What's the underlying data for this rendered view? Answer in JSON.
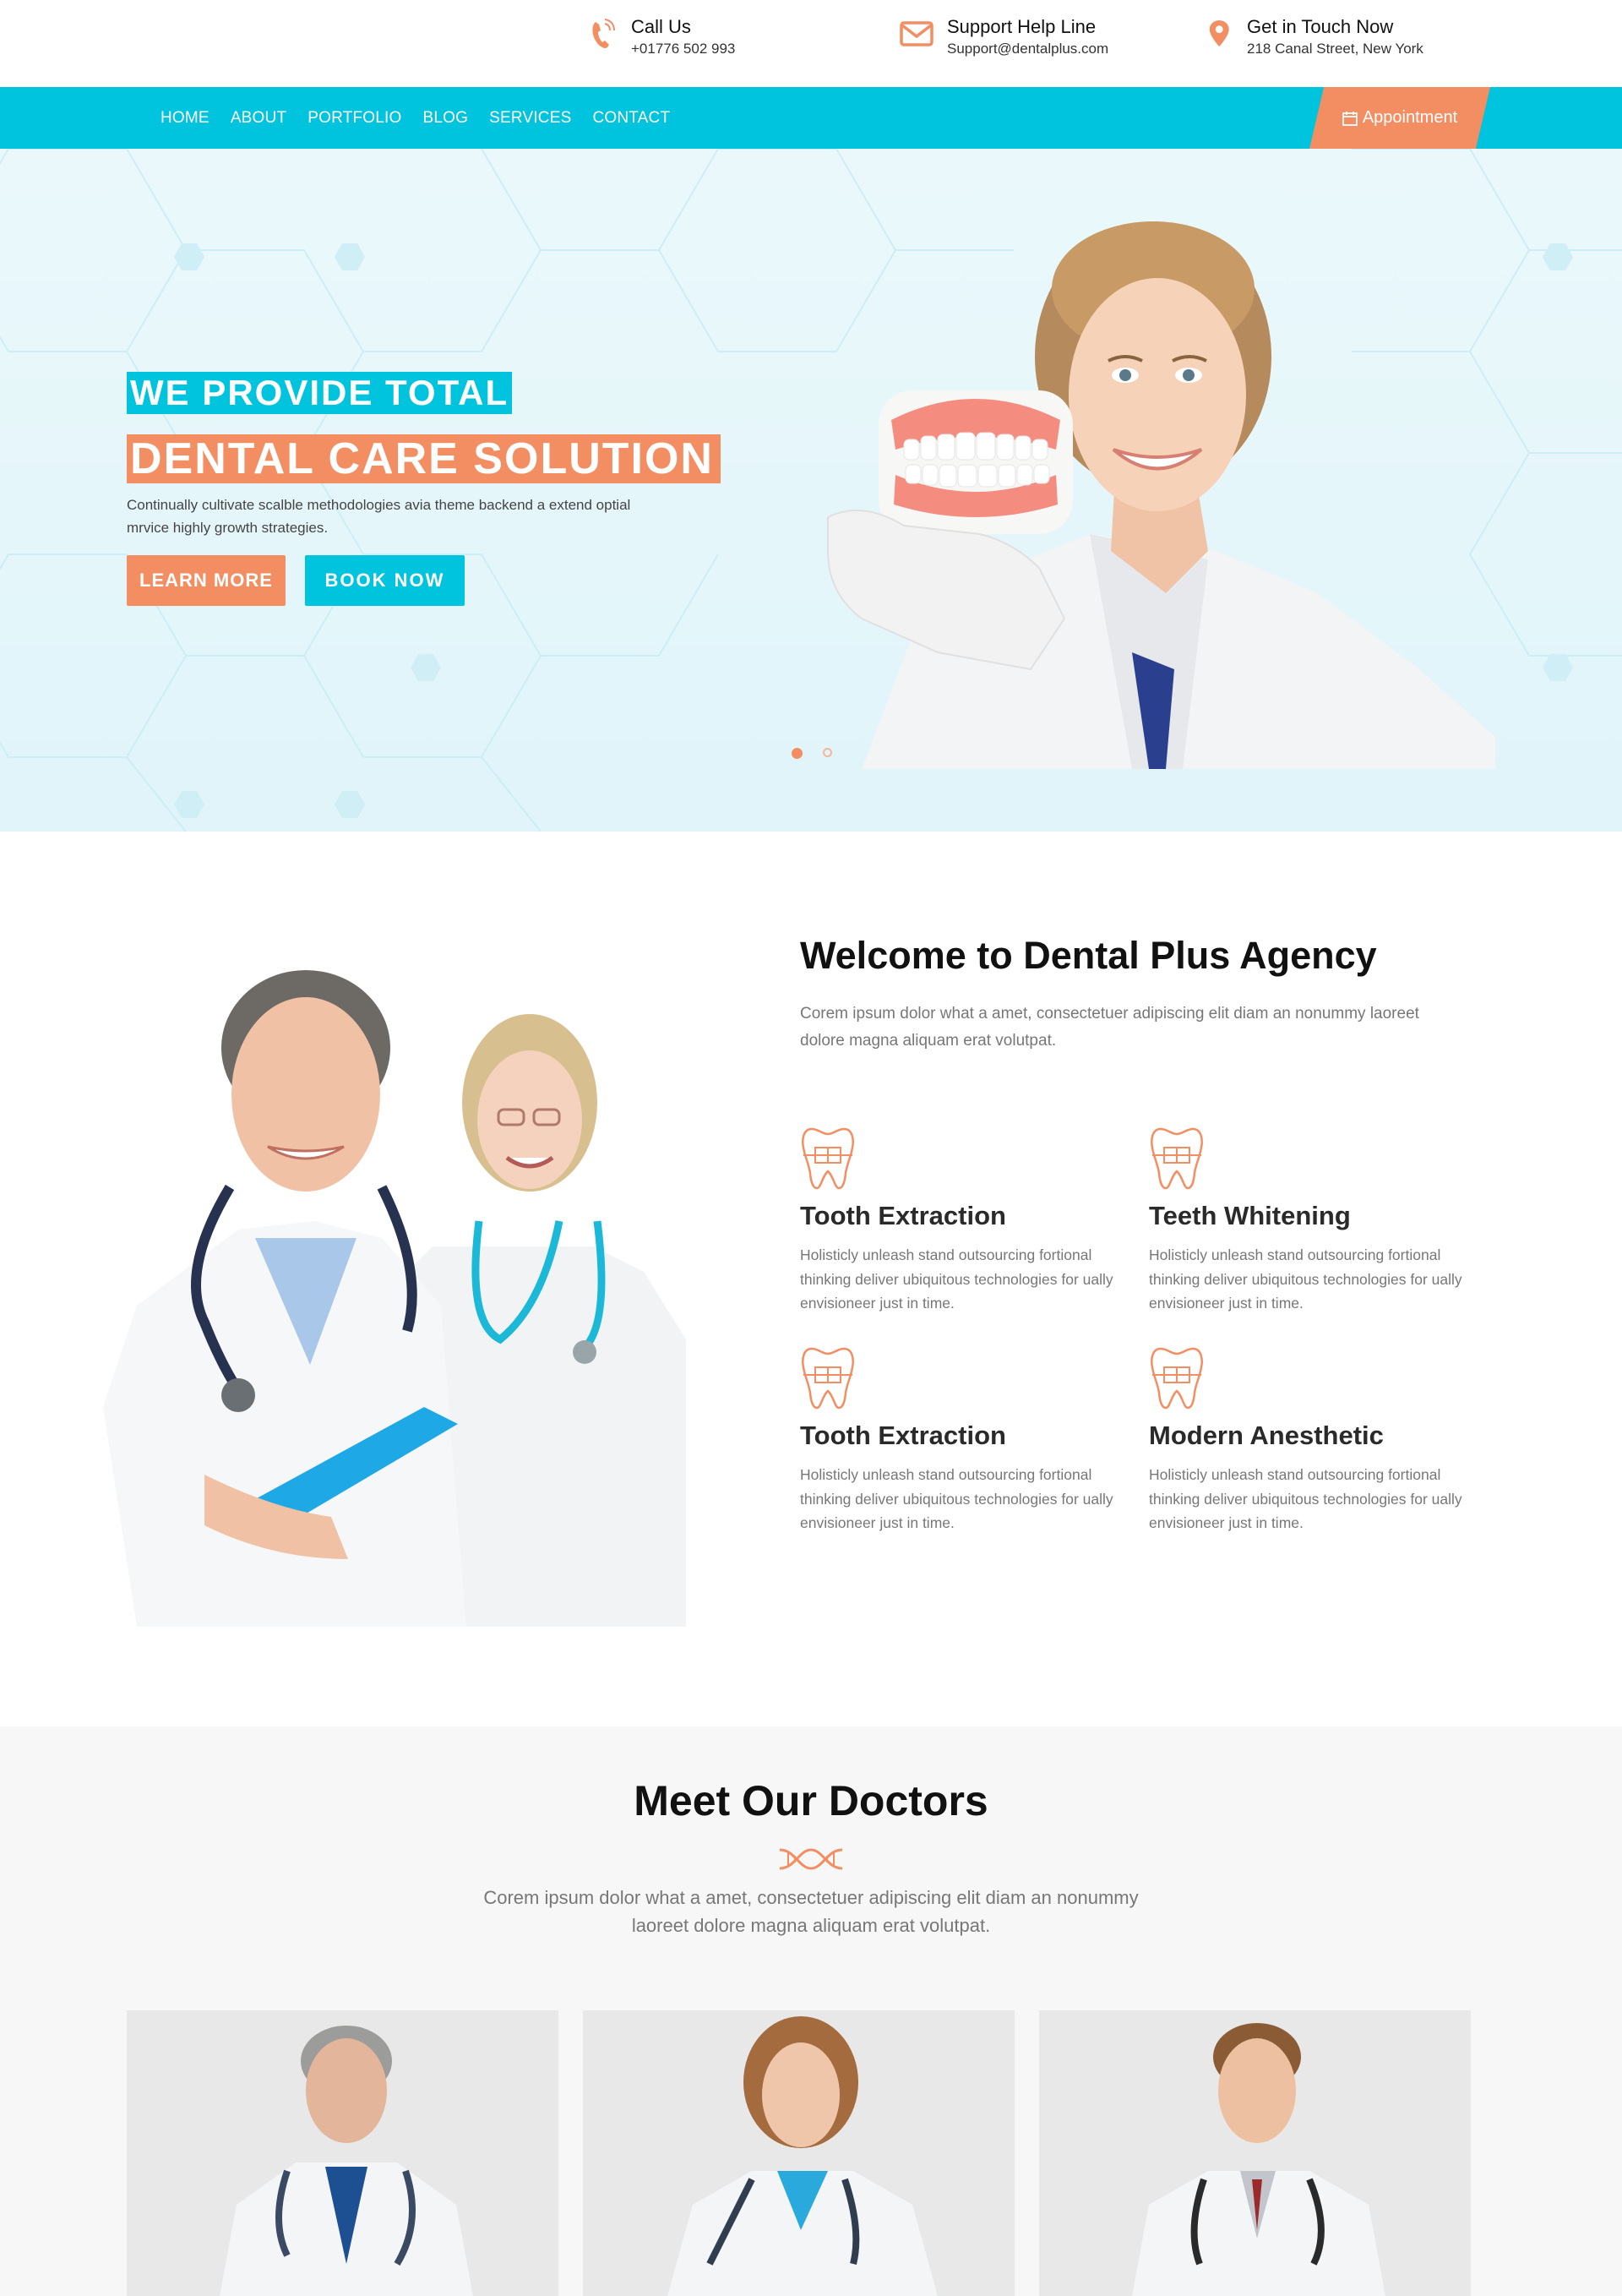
{
  "topbar": {
    "call": {
      "title": "Call Us",
      "sub": "+01776 502 993",
      "icon": "phone-icon"
    },
    "support": {
      "title": "Support Help Line",
      "sub": "Support@dentalplus.com",
      "icon": "envelope-icon"
    },
    "location": {
      "title": "Get in Touch Now",
      "sub": "218 Canal Street, New York",
      "icon": "map-pin-icon"
    }
  },
  "nav": {
    "items": [
      "HOME",
      "ABOUT",
      "PORTFOLIO",
      "BLOG",
      "SERVICES",
      "CONTACT"
    ],
    "appointment": "Appointment"
  },
  "hero": {
    "line1": "WE PROVIDE TOTAL",
    "line2": "DENTAL CARE SOLUTION",
    "desc": "Continually cultivate scalble methodologies avia theme backend a extend optial mrvice highly growth strategies.",
    "learn_more": "LEARN MORE",
    "book_now": "BOOK NOW",
    "slides": 2,
    "active_slide": 1
  },
  "welcome": {
    "title": "Welcome to Dental Plus Agency",
    "desc": "Corem ipsum dolor what a amet, consectetuer adipiscing elit diam an nonummy laoreet dolore magna aliquam erat volutpat.",
    "services": [
      {
        "title": "Tooth Extraction",
        "desc": "Holisticly unleash stand outsourcing fortional thinking deliver ubiquitous technologies for ually envisioneer just in time."
      },
      {
        "title": "Teeth Whitening",
        "desc": "Holisticly unleash stand outsourcing fortional thinking deliver ubiquitous technologies for ually envisioneer just in time."
      },
      {
        "title": "Tooth Extraction",
        "desc": "Holisticly unleash stand outsourcing fortional thinking deliver ubiquitous technologies for ually envisioneer just in time."
      },
      {
        "title": "Modern Anesthetic",
        "desc": "Holisticly unleash stand outsourcing fortional thinking deliver ubiquitous technologies for ually envisioneer just in time."
      }
    ]
  },
  "doctors": {
    "title": "Meet Our Doctors",
    "desc": "Corem ipsum dolor what a amet, consectetuer adipiscing elit diam an nonummy laoreet dolore magna aliquam erat volutpat."
  },
  "colors": {
    "accent": "#00c3de",
    "secondary": "#f38e63"
  }
}
